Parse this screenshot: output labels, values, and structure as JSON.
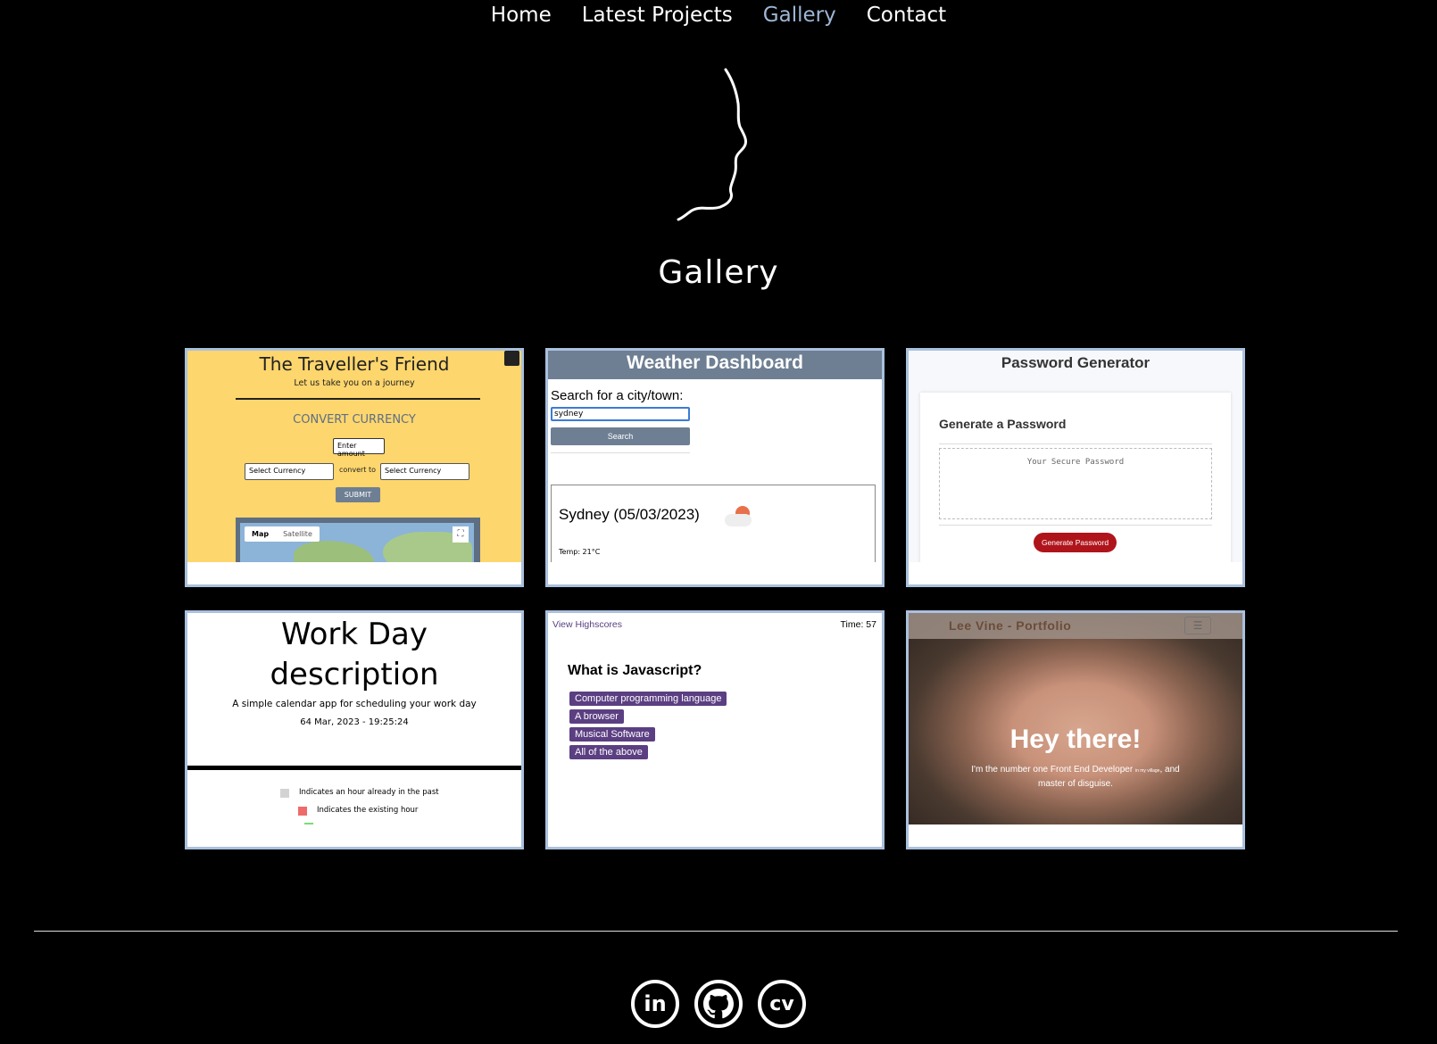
{
  "nav": {
    "items": [
      "Home",
      "Latest Projects",
      "Gallery",
      "Contact"
    ],
    "active": "Gallery"
  },
  "page": {
    "title": "Gallery"
  },
  "colors": {
    "background": "#000000",
    "nav_active": "#9db6d6",
    "card_border": "#aac0dd",
    "traveller_bg": "#fdd66d",
    "weather_header": "#6e7f93",
    "password_button": "#b0141b",
    "quiz_tag": "#5b3f82"
  },
  "cards": {
    "traveller": {
      "title": "The Traveller's Friend",
      "subtitle": "Let us take you on a journey",
      "heading": "CONVERT CURRENCY",
      "amount_placeholder": "Enter amount",
      "select_from": "Select Currency",
      "convert_to": "convert to",
      "select_to": "Select Currency",
      "submit": "SUBMIT",
      "map_tab": "Map",
      "satellite_tab": "Satellite"
    },
    "weather": {
      "title": "Weather Dashboard",
      "search_label": "Search for a city/town:",
      "search_value": "sydney",
      "search_button": "Search",
      "city_date": "Sydney (05/03/2023)",
      "temp": "Temp: 21°C"
    },
    "password": {
      "title": "Password Generator",
      "card_heading": "Generate a Password",
      "placeholder": "Your Secure Password",
      "button": "Generate Password"
    },
    "workday": {
      "title": "Work Day description",
      "subtitle": "A simple calendar app for scheduling your work day",
      "datetime": "64 Mar, 2023 - 19:25:24",
      "legend": [
        "Indicates an hour already in the past",
        "Indicates the existing hour"
      ]
    },
    "quiz": {
      "highscores": "View Highscores",
      "timer": "Time: 57",
      "question": "What is Javascript?",
      "answers": [
        "Computer programming language",
        "A browser",
        "Musical Software",
        "All of the above"
      ]
    },
    "portfolio": {
      "brand": "Lee Vine - Portfolio",
      "headline": "Hey there!",
      "tagline_1": "I'm the number one Front End Developer",
      "tagline_small": "in my village",
      "tagline_2": ", and",
      "tagline_3": "master of disguise."
    }
  },
  "social": [
    {
      "name": "linkedin",
      "label": "in"
    },
    {
      "name": "github",
      "label": ""
    },
    {
      "name": "cv",
      "label": "cv"
    }
  ]
}
